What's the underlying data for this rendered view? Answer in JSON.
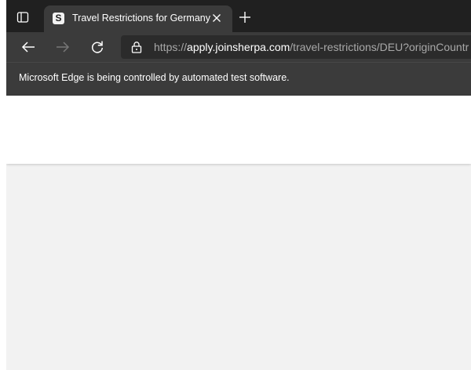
{
  "tab": {
    "title": "Travel Restrictions for Germany",
    "favicon_letter": "S",
    "close_icon": "close-icon",
    "new_tab_icon": "plus-icon"
  },
  "toolbar": {
    "back_icon": "back-arrow-icon",
    "forward_icon": "forward-arrow-icon",
    "refresh_icon": "refresh-icon",
    "lock_icon": "lock-icon"
  },
  "address": {
    "scheme": "https://",
    "domain": "apply.joinsherpa.com",
    "path": "/travel-restrictions/DEU?originCountr"
  },
  "infobar": {
    "message": "Microsoft Edge is being controlled by automated test software."
  },
  "colors": {
    "tabbar_bg": "#202020",
    "toolbar_bg": "#3b3b3b",
    "address_bg": "#2b2b2b",
    "page_bg": "#f2f2f2",
    "header_bg": "#ffffff"
  }
}
